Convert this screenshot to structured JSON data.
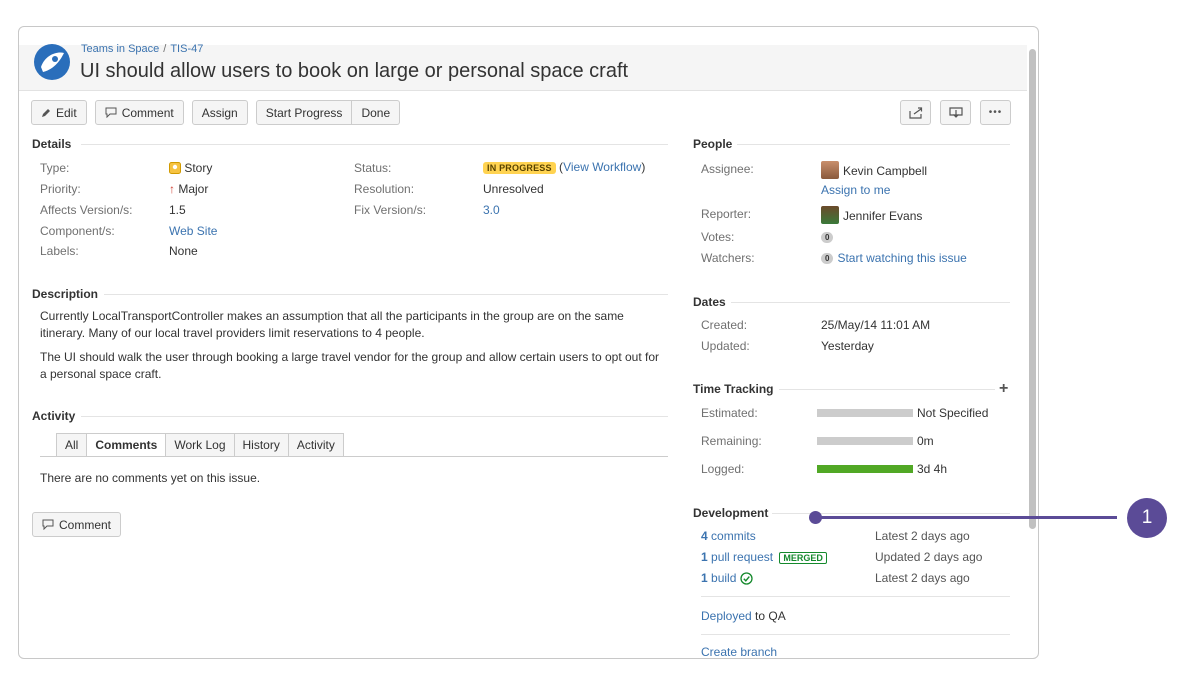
{
  "breadcrumb": {
    "project": "Teams in Space",
    "issue_key": "TIS-47"
  },
  "issue": {
    "title": "UI should allow users to book on large or personal space craft"
  },
  "toolbar": {
    "edit": "Edit",
    "comment": "Comment",
    "assign": "Assign",
    "start_progress": "Start Progress",
    "done": "Done",
    "right_icons": [
      "share-icon",
      "export-icon",
      "more-icon"
    ],
    "more_label": "•••"
  },
  "details": {
    "title": "Details",
    "type_label": "Type:",
    "type_value": "Story",
    "priority_label": "Priority:",
    "priority_value": "Major",
    "affects_label": "Affects Version/s:",
    "affects_value": "1.5",
    "components_label": "Component/s:",
    "components_value": "Web Site",
    "labels_label": "Labels:",
    "labels_value": "None",
    "status_label": "Status:",
    "status_value": "IN PROGRESS",
    "view_workflow": "View Workflow",
    "resolution_label": "Resolution:",
    "resolution_value": "Unresolved",
    "fix_label": "Fix Version/s:",
    "fix_value": "3.0"
  },
  "description": {
    "title": "Description",
    "p1": "Currently LocalTransportController makes an assumption that all the participants in the group are on the same itinerary. Many of our local travel providers limit reservations to 4 people.",
    "p2": "The UI should walk the user through booking a large travel vendor for the group and allow certain users to opt out for a personal space craft."
  },
  "activity": {
    "title": "Activity",
    "tabs": [
      "All",
      "Comments",
      "Work Log",
      "History",
      "Activity"
    ],
    "active_tab": "Comments",
    "empty": "There are no comments yet on this issue.",
    "comment_button": "Comment"
  },
  "people": {
    "title": "People",
    "assignee_label": "Assignee:",
    "assignee": "Kevin Campbell",
    "assign_to_me": "Assign to me",
    "reporter_label": "Reporter:",
    "reporter": "Jennifer Evans",
    "votes_label": "Votes:",
    "votes": "0",
    "watchers_label": "Watchers:",
    "watchers": "0",
    "start_watching": "Start watching this issue"
  },
  "dates": {
    "title": "Dates",
    "created_label": "Created:",
    "created": "25/May/14 11:01 AM",
    "updated_label": "Updated:",
    "updated": "Yesterday"
  },
  "time_tracking": {
    "title": "Time Tracking",
    "add": "+",
    "estimated_label": "Estimated:",
    "estimated": "Not Specified",
    "estimated_fill": 0,
    "remaining_label": "Remaining:",
    "remaining": "0m",
    "remaining_fill": 0,
    "logged_label": "Logged:",
    "logged": "3d 4h",
    "logged_fill": 1.0
  },
  "development": {
    "title": "Development",
    "commits_count": "4",
    "commits_label": "commits",
    "commits_time": "Latest 2 days ago",
    "pr_count": "1",
    "pr_label": "pull request",
    "pr_badge": "MERGED",
    "pr_time": "Updated 2 days ago",
    "build_count": "1",
    "build_label": "build",
    "build_time": "Latest 2 days ago",
    "deployed_link": "Deployed",
    "deployed_rest": "to QA",
    "create_branch": "Create branch"
  },
  "callout": {
    "number": "1"
  },
  "colors": {
    "accent": "#5b4b97",
    "link": "#3b73af",
    "in_progress": "#ffd351",
    "merged": "#14892c",
    "logged": "#51a825"
  }
}
